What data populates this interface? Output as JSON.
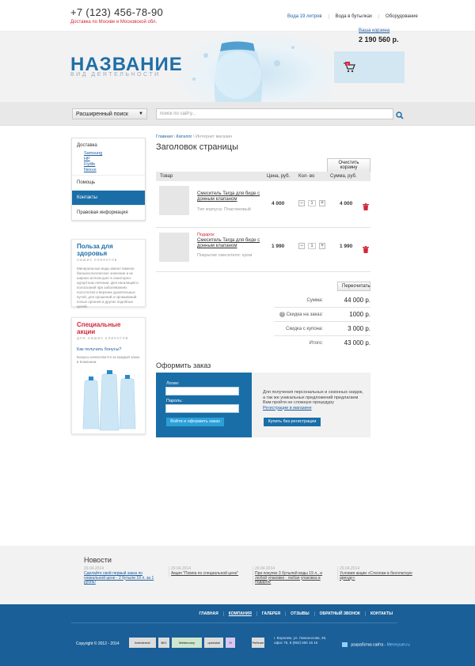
{
  "topbar": {
    "phone": "+7 (123) 456-78-90",
    "delivery": "Доставка по Москве и Московской обл.",
    "nav": [
      "Вода 19 литров",
      "Вода в бутылках",
      "Оборудование"
    ]
  },
  "header": {
    "logo": "НАЗВАНИЕ",
    "slogan": "вид деятельности",
    "cart_link": "Ваша корзина",
    "cart_sum": "2 190 560 р.",
    "cart_count": "2"
  },
  "search": {
    "advanced_label": "Расширенный поиск",
    "placeholder": "поиск по сайту..."
  },
  "sidebar": {
    "items": [
      {
        "label": "Доставка",
        "subitems": [
          "Samsung",
          "HP",
          "Flylife",
          "Nexus"
        ]
      },
      {
        "label": "Помощь"
      },
      {
        "label": "Контакты",
        "active": true
      },
      {
        "label": "Правовая информация"
      }
    ],
    "health": {
      "title": "Польза для здоровья",
      "subtitle": "наших клиентов",
      "text": "Минеральные воды имеют важное бальнеологическое значение и их широко используют в санаторно-курортном лечении. Для ингаляций и полосканий при заболеваниях носоглотки и верхних дыхательных путей, для орошений и промываний полых органов и других подобных целей."
    },
    "promo": {
      "title": "Специальные акции",
      "subtitle": "для наших клиентов",
      "link": "Как получать бонусы?",
      "text": "Бонусы начисляются за каждый заказ в Компании."
    }
  },
  "breadcrumb": [
    "Главная",
    "Каталог",
    "Интернет магазин"
  ],
  "page_title": "Заголовок страницы",
  "clear_cart": "Очистить корзину",
  "table": {
    "headers": [
      "Товар",
      "Цена, руб.",
      "Кол- во",
      "Сумма, руб."
    ],
    "rows": [
      {
        "name": "Смеситель Targa для биде с донным клапаном",
        "prop": "Тип корпуса: Пластиковый",
        "promo": "",
        "price": "4 000",
        "qty": "1",
        "sum": "4 000"
      },
      {
        "name": "Смеситель Targa для биде с донным клапаном",
        "prop": "Покрытие смесителя: хром",
        "promo": "Подарок",
        "price": "1 990",
        "qty": "1",
        "sum": "1 990"
      }
    ]
  },
  "recalc": "Пересчитать",
  "totals": [
    {
      "label": "Сумма:",
      "value": "44 000 р."
    },
    {
      "label": "Скидка на заказ:",
      "value": "1000 р."
    },
    {
      "label": "Скидка с купона:",
      "value": "3 000 р."
    },
    {
      "label": "Итого:",
      "value": "43 000 р."
    }
  ],
  "order": {
    "title": "Оформить заказ",
    "login_label": "Логин:",
    "password_label": "Пароль:",
    "login_button": "Войти и оформить заказ",
    "reg_text": "Для получения персональных и сезонных скидок, а так же уникальных предложений предлагаем Вам пройти не сложную процедуру",
    "reg_link": "Регистрации в магазине",
    "buy_button": "Купить без регистрации"
  },
  "news": {
    "title": "Новости",
    "items": [
      {
        "date": "29.04.2014",
        "text": "Сделайте свой первый заказ по уникальной цене - 2 бутыли 19 л. за 1 рубль!"
      },
      {
        "date": "29.04.2014",
        "text": "Акция \"Помпа по специальной цене\""
      },
      {
        "date": "29.04.2014",
        "text": "При покупке 3 бутылей воды 19 л., и любой упаковки - любая упаковка в подарок!"
      },
      {
        "date": "29.04.2014",
        "text": "Условия акции «Стеллаж в бесплатную аренду»"
      }
    ]
  },
  "footer": {
    "nav": [
      "ГЛАВНАЯ",
      "КОМПАНИЯ",
      "ГАЛЕРЕЯ",
      "ОТЗЫВЫ",
      "ОБРАТНЫЙ ЗВОНОК",
      "КОНТАКТЫ"
    ],
    "copyright": "Copyright © 2012 - 2014",
    "counters": [
      "liveinternet",
      "BIG",
      "Webmoney",
      "openstat",
      "!!!",
      "Рейтинг"
    ],
    "address": "г. Воронеж, ул. Ломоносова, 26, офис 76, 8 (952) 555 16 15",
    "dev_text": "разработка сайта -",
    "dev_link": "Merexyum.ru"
  }
}
